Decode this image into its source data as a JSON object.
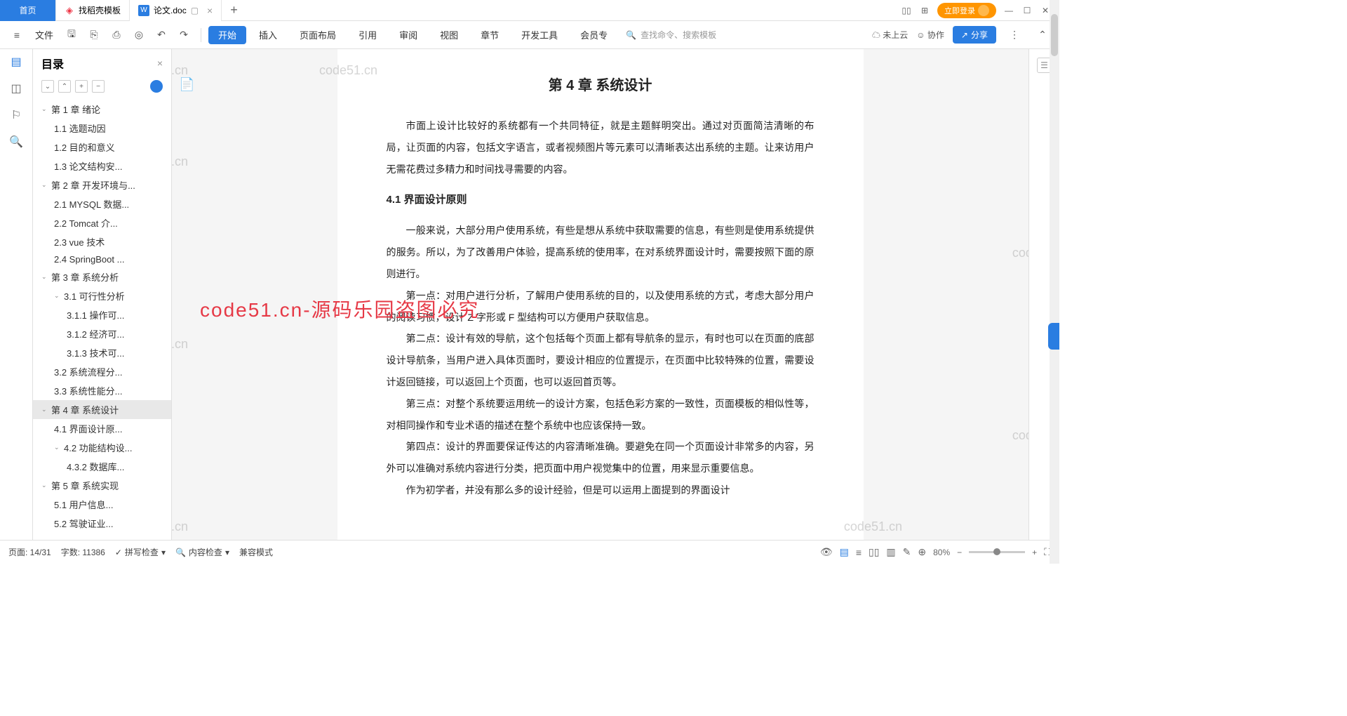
{
  "tabs": {
    "home": "首页",
    "t1": "找稻壳模板",
    "t2": "论文.doc",
    "add": "+"
  },
  "login": "立即登录",
  "ribbon": {
    "file": "文件",
    "menus": [
      "开始",
      "插入",
      "页面布局",
      "引用",
      "审阅",
      "视图",
      "章节",
      "开发工具",
      "会员专"
    ],
    "search": "查找命令、搜索模板",
    "cloud": "未上云",
    "coop": "协作",
    "share": "分享"
  },
  "outline": {
    "title": "目录",
    "items": [
      {
        "l": 1,
        "t": "第 1 章  绪论",
        "c": true
      },
      {
        "l": 2,
        "t": "1.1 选题动因"
      },
      {
        "l": 2,
        "t": "1.2 目的和意义"
      },
      {
        "l": 2,
        "t": "1.3 论文结构安..."
      },
      {
        "l": 1,
        "t": "第 2 章  开发环境与...",
        "c": true
      },
      {
        "l": 2,
        "t": "2.1 MYSQL 数据..."
      },
      {
        "l": 2,
        "t": "2.2 Tomcat  介..."
      },
      {
        "l": 2,
        "t": "2.3 vue 技术"
      },
      {
        "l": 2,
        "t": "2.4 SpringBoot ..."
      },
      {
        "l": 1,
        "t": "第 3 章  系统分析",
        "c": true
      },
      {
        "l": 2,
        "t": "3.1 可行性分析",
        "c": true
      },
      {
        "l": 3,
        "t": "3.1.1 操作可..."
      },
      {
        "l": 3,
        "t": "3.1.2 经济可..."
      },
      {
        "l": 3,
        "t": "3.1.3 技术可..."
      },
      {
        "l": 2,
        "t": "3.2 系统流程分..."
      },
      {
        "l": 2,
        "t": "3.3 系统性能分..."
      },
      {
        "l": 1,
        "t": "第 4 章  系统设计",
        "c": true,
        "cur": true
      },
      {
        "l": 2,
        "t": "4.1 界面设计原..."
      },
      {
        "l": 2,
        "t": "4.2 功能结构设...",
        "c": true
      },
      {
        "l": 3,
        "t": "4.3.2 数据库..."
      },
      {
        "l": 1,
        "t": "第 5 章  系统实现",
        "c": true
      },
      {
        "l": 2,
        "t": "5.1 用户信息..."
      },
      {
        "l": 2,
        "t": "5.2 驾驶证业..."
      }
    ]
  },
  "doc": {
    "title": "第 4 章  系统设计",
    "p1": "市面上设计比较好的系统都有一个共同特征，就是主题鲜明突出。通过对页面简洁清晰的布局，让页面的内容，包括文字语言，或者视频图片等元素可以清晰表达出系统的主题。让来访用户无需花费过多精力和时间找寻需要的内容。",
    "h3": "4.1 界面设计原则",
    "p2": "一般来说，大部分用户使用系统，有些是想从系统中获取需要的信息，有些则是使用系统提供的服务。所以，为了改善用户体验，提高系统的使用率，在对系统界面设计时，需要按照下面的原则进行。",
    "p3": "第一点：对用户进行分析，了解用户使用系统的目的，以及使用系统的方式，考虑大部分用户的阅读习惯，设计 Z 字形或 F 型结构可以方便用户获取信息。",
    "p4": "第二点：设计有效的导航，这个包括每个页面上都有导航条的显示，有时也可以在页面的底部设计导航条，当用户进入具体页面时，要设计相应的位置提示，在页面中比较特殊的位置，需要设计返回链接，可以返回上个页面，也可以返回首页等。",
    "p5": "第三点：对整个系统要运用统一的设计方案，包括色彩方案的一致性，页面模板的相似性等，对相同操作和专业术语的描述在整个系统中也应该保持一致。",
    "p6": "第四点：设计的界面要保证传达的内容清晰准确。要避免在同一个页面设计非常多的内容，另外可以准确对系统内容进行分类，把页面中用户视觉集中的位置，用来显示重要信息。",
    "p7": "作为初学者，并没有那么多的设计经验，但是可以运用上面提到的界面设计"
  },
  "status": {
    "page": "页面: 14/31",
    "words": "字数: 11386",
    "spell": "拼写检查",
    "content": "内容检查",
    "compat": "兼容模式",
    "zoom": "80%"
  },
  "wm": "code51.cn",
  "wm_red": "code51.cn-源码乐园盗图必究"
}
